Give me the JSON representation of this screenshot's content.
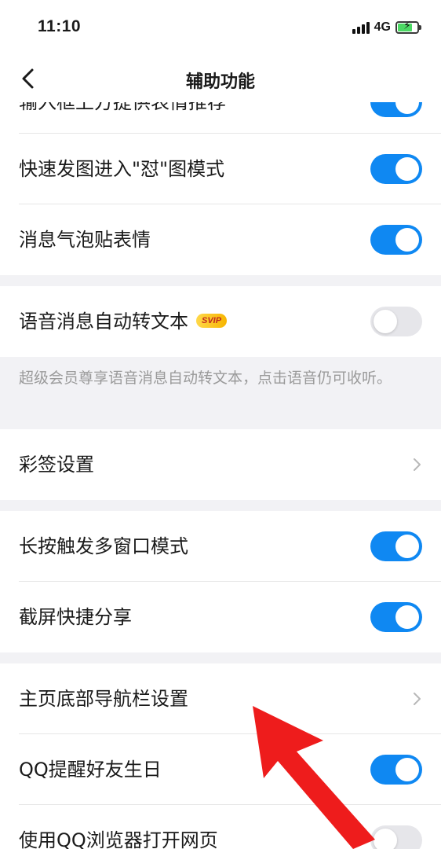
{
  "status_bar": {
    "time": "11:10",
    "network": "4G",
    "battery_color": "#4cd964",
    "battery_level_fraction": 0.8,
    "icons": [
      "signal-bars-icon",
      "battery-charging-icon"
    ]
  },
  "nav": {
    "title": "辅助功能",
    "back_icon": "chevron-left-icon"
  },
  "settings": {
    "partial_top_label": "输入框上方提供表情推荐",
    "quick_send_image": "快速发图进入\"怼\"图模式",
    "bubble_sticker": "消息气泡贴表情",
    "voice_to_text": "语音消息自动转文本",
    "svip_badge": "SVIP",
    "voice_to_text_note": "超级会员尊享语音消息自动转文本，点击语音仍可收听。",
    "color_sign": "彩签设置",
    "long_press_multiwindow": "长按触发多窗口模式",
    "screenshot_share": "截屏快捷分享",
    "bottom_nav_settings": "主页底部导航栏设置",
    "birthday_reminder": "QQ提醒好友生日",
    "open_in_qq_browser": "使用QQ浏览器打开网页"
  },
  "toggle_states": {
    "partial_top": true,
    "quick_send_image": true,
    "bubble_sticker": true,
    "voice_to_text": false,
    "long_press_multiwindow": true,
    "screenshot_share": true,
    "birthday_reminder": true,
    "open_in_qq_browser": false
  },
  "colors": {
    "accent": "#0f88f2",
    "toggle_off": "#e6e6ea",
    "annotation_arrow": "#ee1c1c"
  }
}
